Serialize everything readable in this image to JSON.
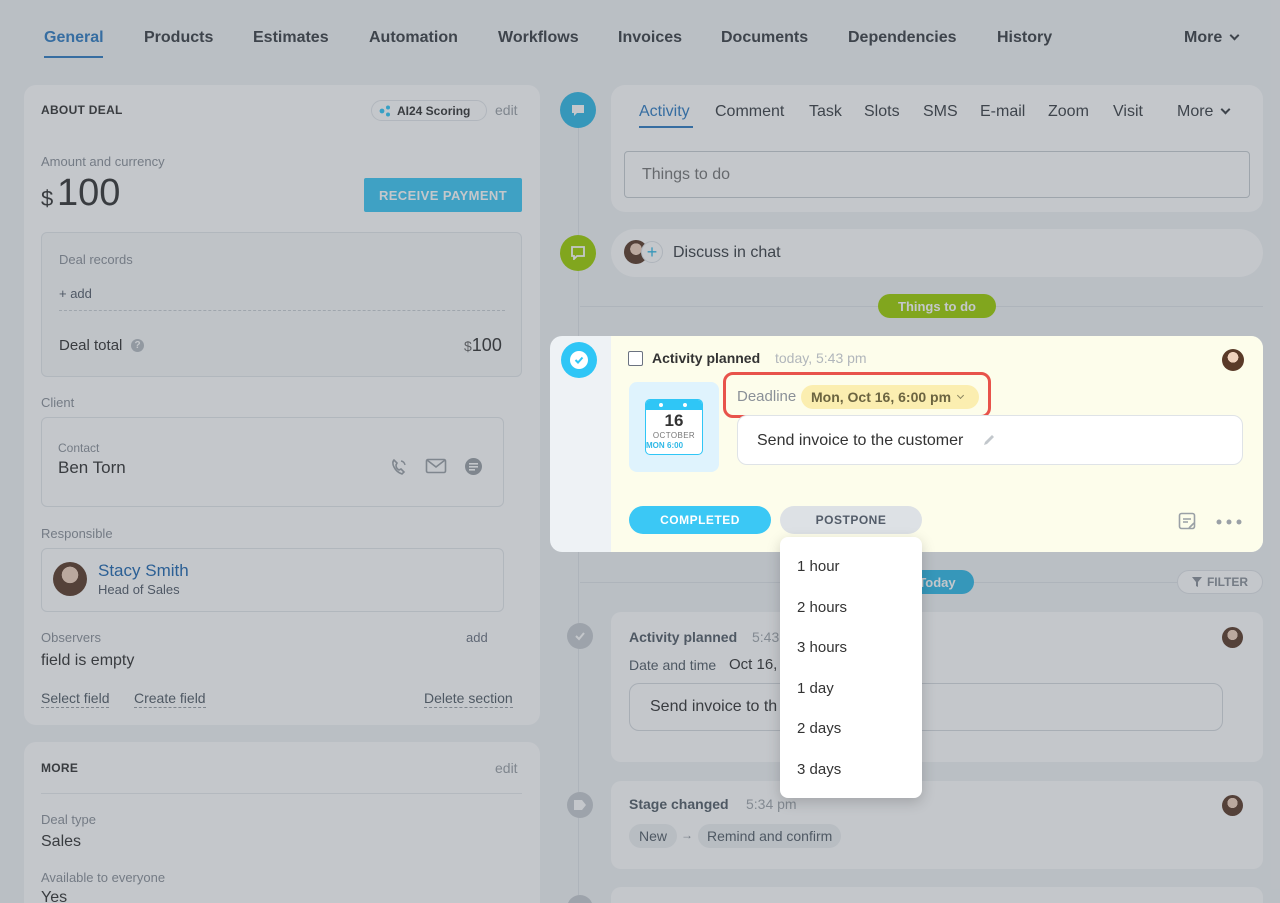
{
  "top_tabs": [
    "General",
    "Products",
    "Estimates",
    "Automation",
    "Workflows",
    "Invoices",
    "Documents",
    "Dependencies",
    "History",
    "More"
  ],
  "about_deal": {
    "title": "ABOUT DEAL",
    "scoring_badge": "AI24 Scoring",
    "edit": "edit",
    "amount_label": "Amount and currency",
    "currency_symbol": "$",
    "amount": "100",
    "receive_payment": "RECEIVE PAYMENT",
    "deal_records": "Deal records",
    "add": "+ add",
    "deal_total_label": "Deal total",
    "deal_total_currency": "$",
    "deal_total_value": "100",
    "client_label": "Client",
    "contact_label": "Contact",
    "contact_name": "Ben Torn",
    "responsible_label": "Responsible",
    "responsible_name": "Stacy Smith",
    "responsible_role": "Head of Sales",
    "observers_label": "Observers",
    "observers_add": "add",
    "observers_value": "field is empty",
    "select_field": "Select field",
    "create_field": "Create field",
    "delete_section": "Delete section"
  },
  "more_section": {
    "title": "MORE",
    "edit": "edit",
    "deal_type_label": "Deal type",
    "deal_type_value": "Sales",
    "available_label": "Available to everyone",
    "available_value": "Yes"
  },
  "activity_tabs": [
    "Activity",
    "Comment",
    "Task",
    "Slots",
    "SMS",
    "E-mail",
    "Zoom",
    "Visit",
    "More"
  ],
  "things_input_placeholder": "Things to do",
  "discuss_chat": "Discuss in chat",
  "things_to_do_pill": "Things to do",
  "today_pill": "Today",
  "filter_label": "FILTER",
  "planned": {
    "title": "Activity planned",
    "time": "today, 5:43 pm",
    "calendar_day": "16",
    "calendar_month": "OCTOBER",
    "calendar_weekday": "MON",
    "calendar_time": "6:00",
    "deadline_label": "Deadline",
    "deadline_value": "Mon, Oct 16, 6:00 pm",
    "description": "Send invoice to the customer",
    "completed_btn": "COMPLETED",
    "postpone_btn": "POSTPONE"
  },
  "postpone_options": [
    "1 hour",
    "2 hours",
    "3 hours",
    "1 day",
    "2 days",
    "3 days"
  ],
  "history_activity": {
    "title": "Activity planned",
    "time": "5:43",
    "date_label": "Date and time",
    "date_value": "Oct 16,",
    "description": "Send invoice to th"
  },
  "stage_changed": {
    "title": "Stage changed",
    "time": "5:34 pm",
    "from": "New",
    "to": "Remind and confirm"
  },
  "colors": {
    "accent_blue": "#2f7bc1",
    "cyan": "#3bc8f5",
    "green": "#9dcf00",
    "deadline_bg": "#fbeeb0",
    "highlight_red": "#e8534b"
  }
}
